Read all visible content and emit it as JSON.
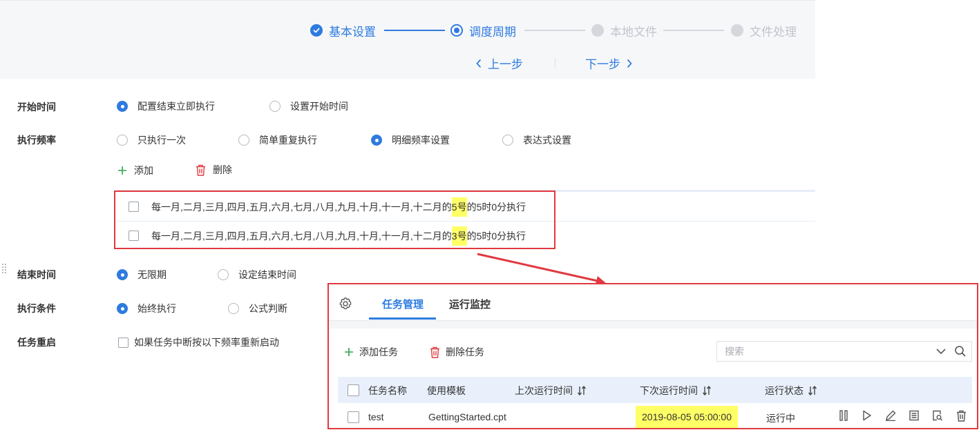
{
  "wizard": {
    "steps": [
      {
        "label": "基本设置",
        "state": "done"
      },
      {
        "label": "调度周期",
        "state": "active"
      },
      {
        "label": "本地文件",
        "state": "todo"
      },
      {
        "label": "文件处理",
        "state": "todo"
      }
    ],
    "prev_label": "上一步",
    "next_label": "下一步"
  },
  "form": {
    "start_time": {
      "label": "开始时间",
      "options": [
        "配置结束立即执行",
        "设置开始时间"
      ],
      "selected": 0
    },
    "frequency": {
      "label": "执行频率",
      "options": [
        "只执行一次",
        "简单重复执行",
        "明细频率设置",
        "表达式设置"
      ],
      "selected": 2,
      "add_label": "添加",
      "delete_label": "删除",
      "rows": [
        {
          "prefix": "每一月,二月,三月,四月,五月,六月,七月,八月,九月,十月,十一月,十二月的",
          "day": "5号",
          "suffix": "的5时0分执行"
        },
        {
          "prefix": "每一月,二月,三月,四月,五月,六月,七月,八月,九月,十月,十一月,十二月的",
          "day": "3号",
          "suffix": "的5时0分执行"
        }
      ]
    },
    "end_time": {
      "label": "结束时间",
      "options": [
        "无限期",
        "设定结束时间"
      ],
      "selected": 0
    },
    "condition": {
      "label": "执行条件",
      "options": [
        "始终执行",
        "公式判断"
      ],
      "selected": 0
    },
    "restart": {
      "label": "任务重启",
      "checkbox_label": "如果任务中断按以下频率重新启动"
    }
  },
  "task_panel": {
    "tabs": [
      "任务管理",
      "运行监控"
    ],
    "active_tab": 0,
    "add_task_label": "添加任务",
    "delete_task_label": "删除任务",
    "search_placeholder": "搜索",
    "columns": [
      "任务名称",
      "使用模板",
      "上次运行时间",
      "下次运行时间",
      "运行状态"
    ],
    "rows": [
      {
        "name": "test",
        "template": "GettingStarted.cpt",
        "last_run": "",
        "next_run": "2019-08-05 05:00:00",
        "status": "运行中"
      }
    ]
  },
  "colors": {
    "accent": "#2e7be0",
    "highlight": "#ffff66",
    "annotation_red": "#e0393e",
    "add_green": "#2da44e",
    "delete_red": "#e0393e"
  },
  "icons": [
    "check-icon",
    "chevron-left-icon",
    "chevron-right-icon",
    "plus-icon",
    "trash-icon",
    "gear-icon",
    "chevron-down-icon",
    "search-icon",
    "sort-icon",
    "pause-icon",
    "play-icon",
    "edit-icon",
    "log-icon",
    "preview-icon",
    "delete-icon",
    "drag-handle-icon"
  ]
}
